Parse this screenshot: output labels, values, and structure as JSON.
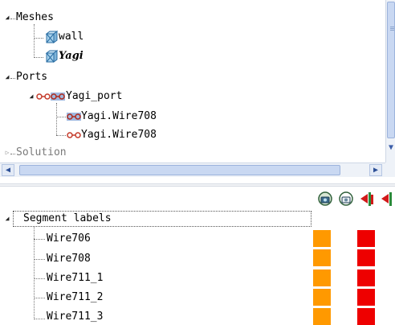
{
  "tree": {
    "meshes_label": "Meshes",
    "mesh_items": [
      "wall",
      "Yagi"
    ],
    "ports_label": "Ports",
    "port_group_label": "Yagi_port",
    "port_items": [
      "Yagi.Wire708",
      "Yagi.Wire708"
    ],
    "solution_label": "Solution"
  },
  "segments": {
    "header": "Segment labels",
    "rows": [
      {
        "label": "Wire706",
        "color_a": "#ff9900",
        "color_b": "#ee0000"
      },
      {
        "label": "Wire708",
        "color_a": "#ff9900",
        "color_b": "#ee0000"
      },
      {
        "label": "Wire711_1",
        "color_a": "#ff9900",
        "color_b": "#ee0000"
      },
      {
        "label": "Wire711_2",
        "color_a": "#ff9900",
        "color_b": "#ee0000"
      },
      {
        "label": "Wire711_3",
        "color_a": "#ff9900",
        "color_b": "#ee0000"
      }
    ]
  },
  "toolbar": {
    "icons": [
      "loop-camera-icon",
      "loop-camera-outline-icon",
      "red-flag-arrow-icon",
      "red-flag-arrow-partial-icon"
    ]
  },
  "colors": {
    "orange": "#ff9900",
    "red": "#ee0000",
    "scroll": "#c9d8f2"
  }
}
